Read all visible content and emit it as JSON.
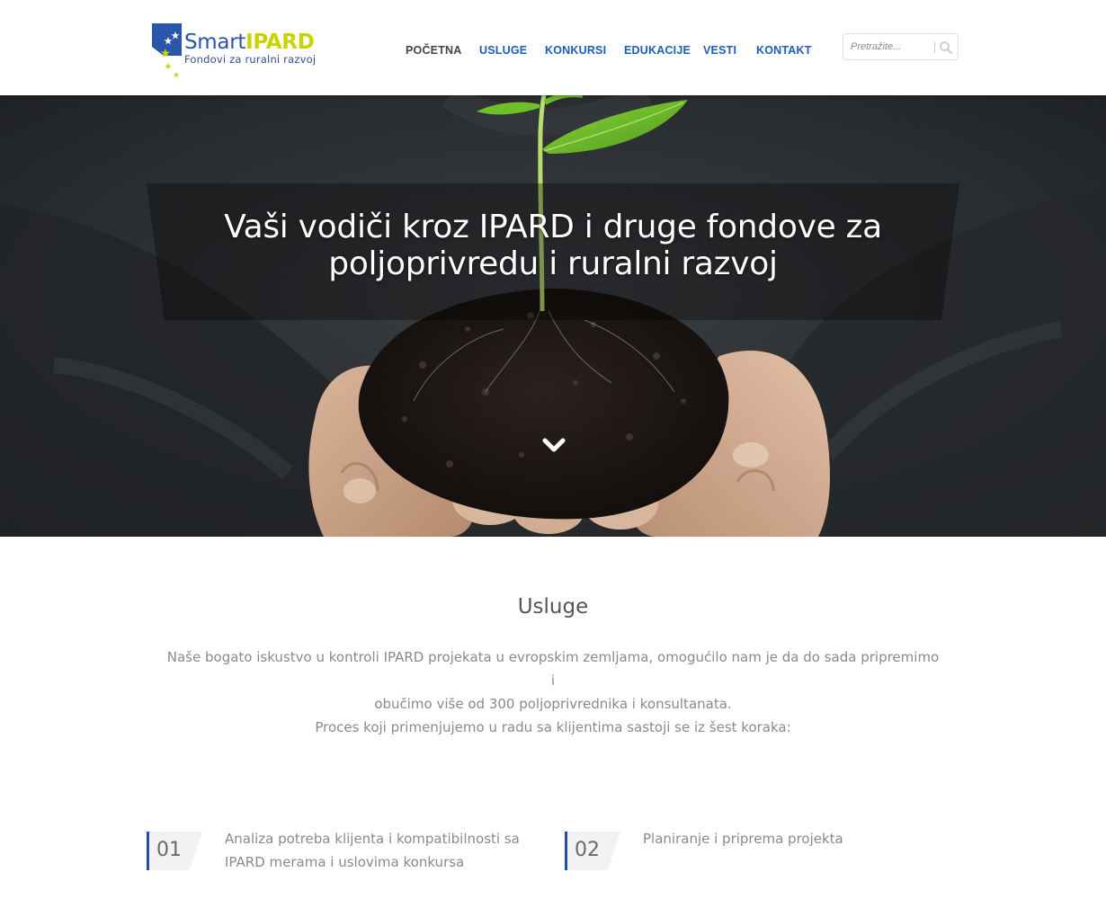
{
  "brand": {
    "name_part1": "Smart",
    "name_part2": "IPARD",
    "tagline": "Fondovi za ruralni razvoj"
  },
  "nav": {
    "items": [
      {
        "label": "POČETNA",
        "active": true
      },
      {
        "label": "USLUGE",
        "active": false
      },
      {
        "label": "KONKURSI",
        "active": false
      },
      {
        "label": "EDUKACIJE",
        "active": false
      },
      {
        "label": "VESTI",
        "active": false
      },
      {
        "label": "KONTAKT",
        "active": false
      }
    ]
  },
  "search": {
    "placeholder": "Pretražite...",
    "icon": "search-icon"
  },
  "hero": {
    "title_line1": "Vaši vodiči kroz IPARD i druge fondove za",
    "title_line2": "poljoprivredu i ruralni razvoj",
    "scroll_icon": "chevron-down-icon"
  },
  "services": {
    "title": "Usluge",
    "intro_line1": "Naše bogato iskustvo u kontroli IPARD projekata u evropskim zemljama, omogućilo nam je da do sada pripremimo i",
    "intro_line2": "obučimo više od 300 poljoprivrednika i konsultanata.",
    "process": "Proces koji primenjujemo u radu sa klijentima sastoji se iz šest koraka:",
    "steps": [
      {
        "number": "01",
        "line1": "Analiza potreba klijenta i kompatibilnosti sa",
        "line2": "IPARD merama i uslovima konkursa"
      },
      {
        "number": "02",
        "line1": "Planiranje i priprema projekta",
        "line2": ""
      }
    ]
  },
  "colors": {
    "brand_blue": "#2b55a8",
    "brand_lime": "#c8d400",
    "nav_link": "#1e5db5",
    "nav_active": "#444444",
    "step_accent": "#1e4fa8"
  }
}
